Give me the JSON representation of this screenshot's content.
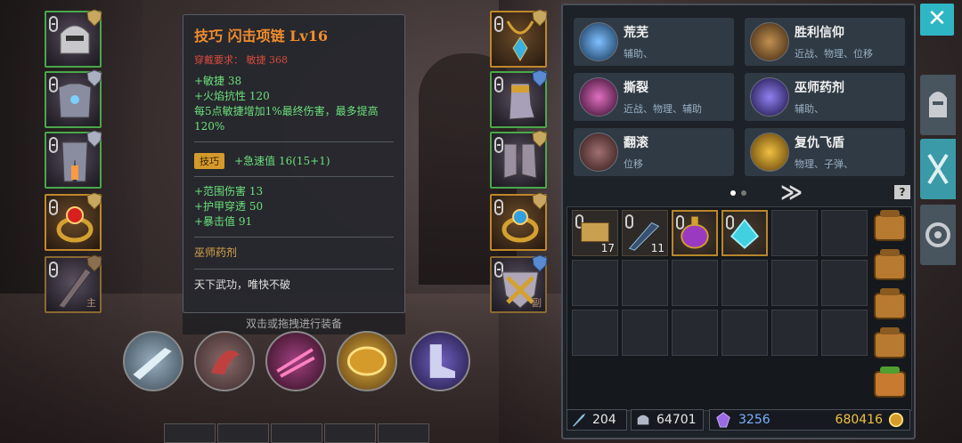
{
  "tooltip": {
    "title": "技巧 闪击项链 Lv16",
    "requirement": "穿戴要求： 敏捷 368",
    "stats_a": [
      "+敏捷 38",
      "+火焰抗性 120",
      "每5点敏捷增加1%最终伤害，最多提高120%"
    ],
    "tag": "技巧",
    "tag_stat": "+急速值 16(15+1)",
    "stats_b": [
      "+范围伤害 13",
      "+护甲穿透 50",
      "+暴击值 91"
    ],
    "set_name": "巫师药剂",
    "flavor": "天下武功，唯快不破"
  },
  "hint": "双击或拖拽进行装备",
  "left_slot_main_label": "主",
  "right_slot_sub_label": "副",
  "skills": [
    {
      "name": "荒芜",
      "tags": "辅助、"
    },
    {
      "name": "胜利信仰",
      "tags": "近战、物理、位移"
    },
    {
      "name": "撕裂",
      "tags": "近战、物理、辅助"
    },
    {
      "name": "巫师药剂",
      "tags": "辅助、"
    },
    {
      "name": "翻滚",
      "tags": "位移"
    },
    {
      "name": "复仇飞盾",
      "tags": "物理、子弹、"
    }
  ],
  "next_arrow": "≫",
  "help": "?",
  "inventory_counts": {
    "scroll": "17",
    "dart": "11"
  },
  "currency": {
    "sword": "204",
    "helmet": "64701",
    "crystal": "3256",
    "gold": "680416"
  },
  "close": "✕",
  "colors": {
    "accent": "#2fb6c4",
    "gold": "#d49a2a",
    "green_border": "#4aa84a"
  }
}
